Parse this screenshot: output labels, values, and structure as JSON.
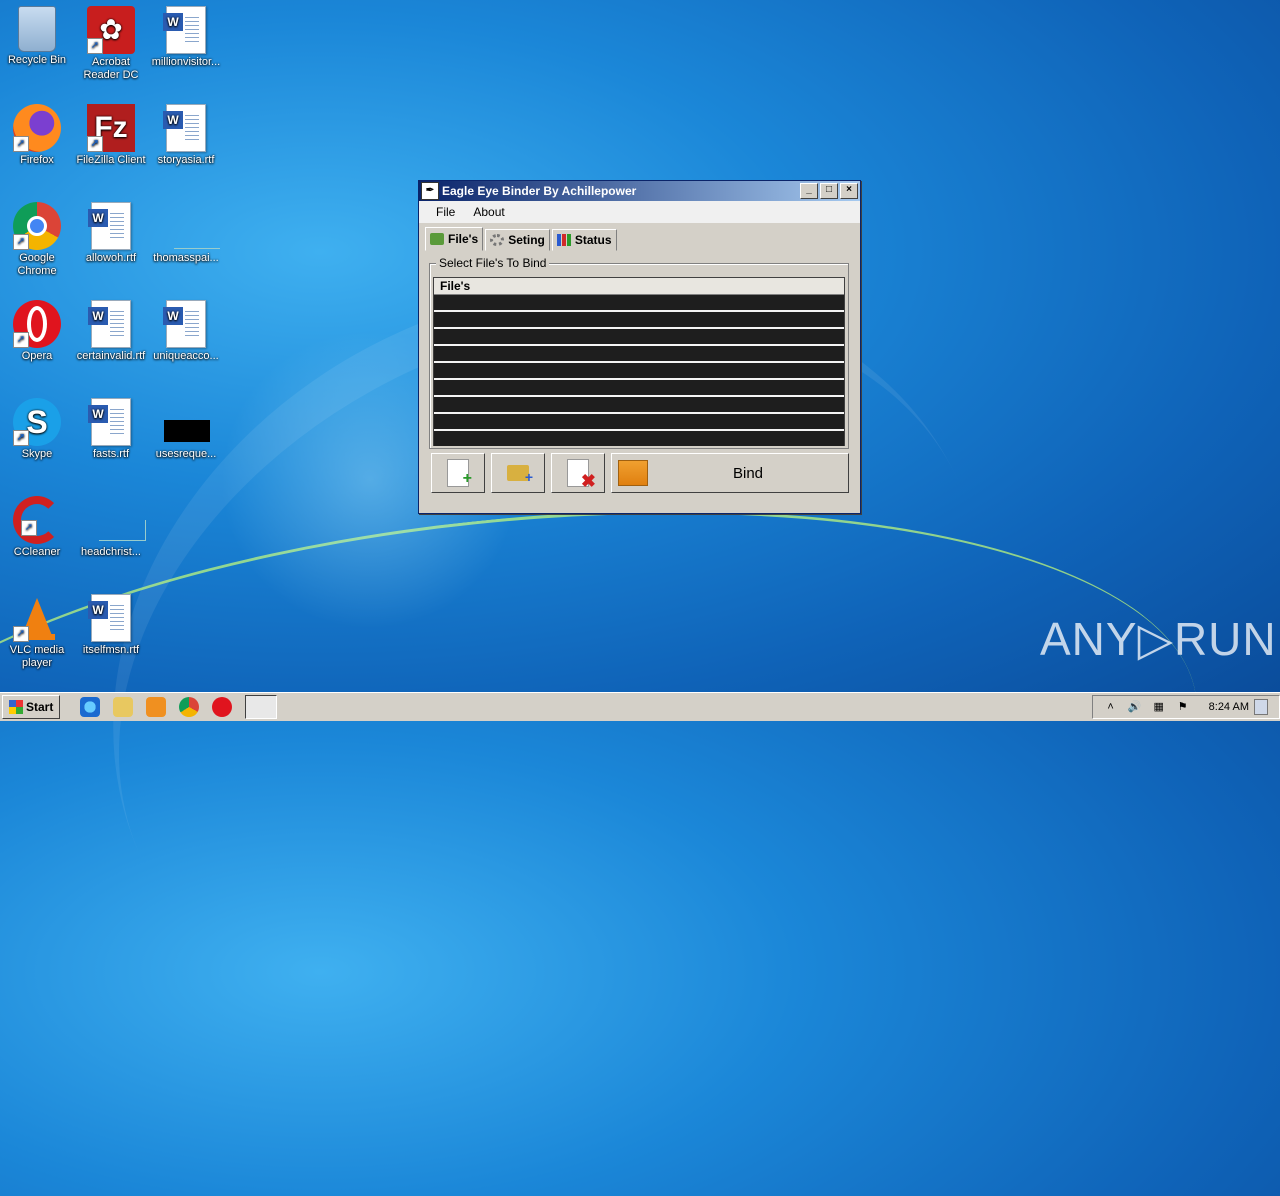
{
  "desktop": {
    "icons": [
      {
        "label": "Recycle Bin"
      },
      {
        "label": "Acrobat Reader DC"
      },
      {
        "label": "millionvisitor..."
      },
      {
        "label": "Firefox"
      },
      {
        "label": "FileZilla Client"
      },
      {
        "label": "storyasia.rtf"
      },
      {
        "label": "Google Chrome"
      },
      {
        "label": "allowoh.rtf"
      },
      {
        "label": "thomasspai..."
      },
      {
        "label": "Opera"
      },
      {
        "label": "certainvalid.rtf"
      },
      {
        "label": "uniqueacco..."
      },
      {
        "label": "Skype"
      },
      {
        "label": "fasts.rtf"
      },
      {
        "label": "usesreque..."
      },
      {
        "label": "CCleaner"
      },
      {
        "label": "headchrist..."
      },
      {
        "label": "VLC media player"
      },
      {
        "label": "itselfmsn.rtf"
      }
    ]
  },
  "window": {
    "title": "Eagle Eye Binder By Achillepower",
    "menu": [
      "File",
      "About"
    ],
    "tabs": [
      "File's",
      "Seting",
      "Status"
    ],
    "group_label": "Select File's To Bind",
    "list_header": "File's",
    "bind_label": "Bind",
    "controls": {
      "minimize": "_",
      "maximize": "□",
      "close": "×"
    }
  },
  "taskbar": {
    "start_label": "Start",
    "clock": "8:24 AM"
  },
  "watermark": "ANY▷RUN"
}
